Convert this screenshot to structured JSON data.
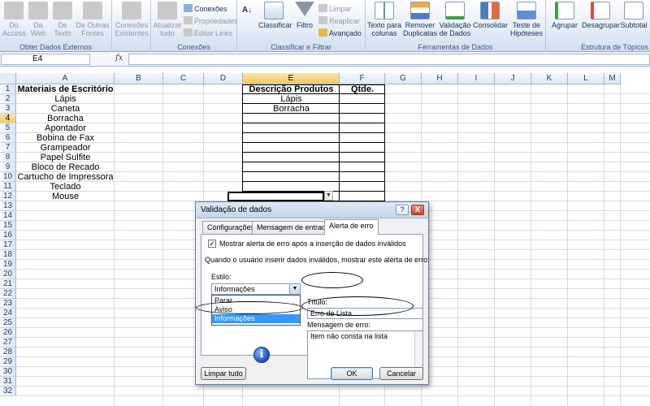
{
  "ribbon": {
    "groups": {
      "external": "Obter Dados Externos",
      "connections": "Conexões",
      "sortfilter": "Classificar e Filtrar",
      "datatools": "Ferramentas de Dados",
      "outline": "Estrutura de Tópicos"
    },
    "buttons": {
      "access": "Do\nAccess",
      "web": "Da\nWeb",
      "text": "De\nTexto",
      "other": "De Outras\nFontes",
      "existing": "Conexões\nExistentes",
      "refresh": "Atualizar\ntudo",
      "conn": "Conexões",
      "props": "Propriedades",
      "editlinks": "Editar Links",
      "az": "A↓",
      "sort": "Classificar",
      "filter": "Filtro",
      "clear": "Limpar",
      "reapply": "Reaplicar",
      "advanced": "Avançado",
      "text_to_cols": "Texto para\ncolunas",
      "remove_dups": "Remover\nDuplicatas",
      "validation": "Validação\nde Dados",
      "consolidate": "Consolidar",
      "whatif": "Teste de\nHipóteses",
      "group": "Agrupar",
      "ungroup": "Desagrupar",
      "subtotal": "Subtotal"
    }
  },
  "formula_bar": {
    "name_box": "E4",
    "fx": "fx",
    "content": ""
  },
  "grid": {
    "columns": [
      "A",
      "B",
      "C",
      "D",
      "E",
      "F",
      "G",
      "H",
      "I",
      "J",
      "K",
      "L",
      "M"
    ],
    "selected_column": "E",
    "selected_row": "4",
    "rows": [
      "1",
      "2",
      "3",
      "4",
      "5",
      "6",
      "7",
      "8",
      "9",
      "10",
      "11",
      "12",
      "13",
      "14",
      "15",
      "16",
      "17",
      "18",
      "19",
      "20",
      "21",
      "22",
      "23",
      "24",
      "25",
      "26",
      "27",
      "28",
      "29",
      "30",
      "31",
      "32"
    ],
    "col_a": [
      "Materiais de Escritório",
      "Lápis",
      "Caneta",
      "Borracha",
      "Apontador",
      "Bobina de Fax",
      "Grampeador",
      "Papel Sulfite",
      "Bloco de Recado",
      "Cartucho de Impressora",
      "Teclado",
      "Mouse"
    ],
    "col_e_header": "Descrição Produtos",
    "col_f_header": "Qtde.",
    "col_e_values": [
      "Lápis",
      "Borracha"
    ]
  },
  "dialog": {
    "title": "Validação de dados",
    "help": "?",
    "close": "X",
    "tabs": [
      "Configurações",
      "Mensagem de entrada",
      "Alerta de erro"
    ],
    "checkbox_label": "Mostrar alerta de erro após a inserção de dados inválidos",
    "checkbox_mark": "✓",
    "when_label": "Quando o usuário inserir dados inválidos, mostrar este alerta de erro:",
    "style_label": "Estilo:",
    "style_value": "Informações",
    "style_options": [
      "Parar",
      "Aviso",
      "Informações"
    ],
    "title_label": "Título:",
    "title_value": "Erro de Lista",
    "message_label": "Mensagem de erro:",
    "message_value": "Item não consta na lista",
    "info_glyph": "i",
    "clear_all": "Limpar tudo",
    "ok": "OK",
    "cancel": "Cancelar"
  }
}
